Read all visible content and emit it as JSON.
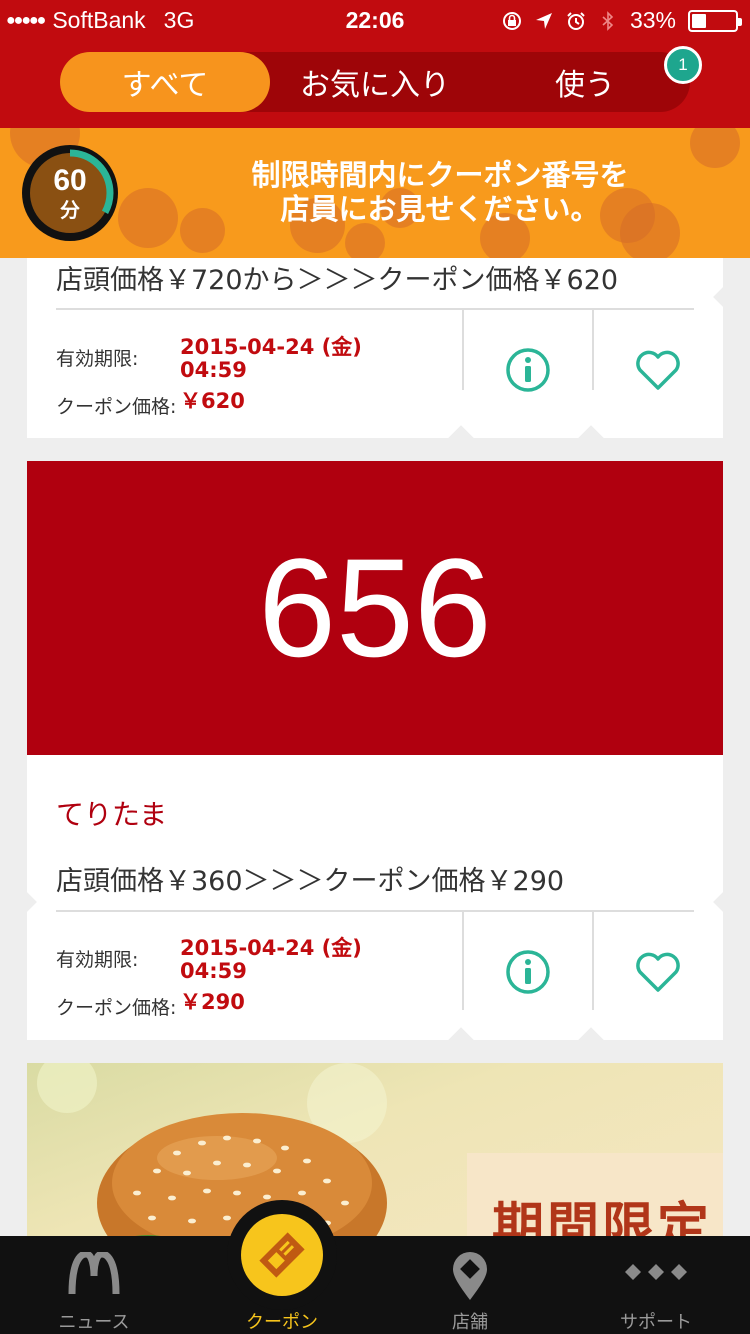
{
  "status_bar": {
    "signal": "●●●●●",
    "carrier": "SoftBank",
    "network": "3G",
    "time": "22:06",
    "battery": "33%",
    "battery_level": 0.33,
    "icons": [
      "rotation-lock-icon",
      "location-icon",
      "alarm-icon",
      "bluetooth-icon",
      "battery-icon"
    ]
  },
  "segments": {
    "all": "すべて",
    "favorites": "お気に入り",
    "use": "使う",
    "active": "all",
    "use_badge": "1"
  },
  "banner": {
    "timer_value": "60",
    "timer_unit": "分",
    "timer_fraction": 0.33,
    "line1": "制限時間内にクーポン番号を",
    "line2": "店員にお見せください。"
  },
  "cards": [
    {
      "price_text": "店頭価格￥720から＞＞＞クーポン価格￥620",
      "expiry_label": "有効期限:",
      "expiry_date": "2015-04-24 (金)",
      "expiry_time": "04:59",
      "price_label": "クーポン価格:",
      "price_value": "￥620"
    },
    {
      "code": "656",
      "name": "てりたま",
      "price_text": "店頭価格￥360＞＞＞クーポン価格￥290",
      "expiry_label": "有効期限:",
      "expiry_date": "2015-04-24 (金)",
      "expiry_time": "04:59",
      "price_label": "クーポン価格:",
      "price_value": "￥290"
    }
  ],
  "promo": {
    "text": "期間限定"
  },
  "tabs": {
    "news": "ニュース",
    "coupon": "クーポン",
    "store": "店舗",
    "support": "サポート"
  },
  "colors": {
    "brand_red": "#c10b0f",
    "orange": "#f7941d",
    "teal": "#2bb597",
    "yellow": "#f7c51c"
  }
}
